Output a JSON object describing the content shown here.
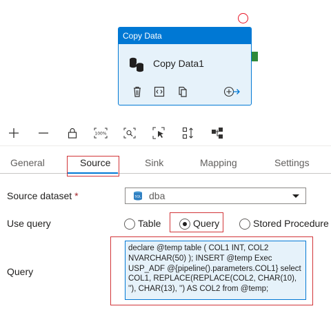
{
  "activity": {
    "type_title": "Copy Data",
    "name": "Copy Data1",
    "tools": [
      "delete-icon",
      "code-icon",
      "copy-icon",
      "add-output-icon"
    ]
  },
  "toolbar": {
    "items": [
      "zoom-in-icon",
      "zoom-out-icon",
      "lock-icon",
      "zoom-100-icon",
      "fit-to-window-icon",
      "select-icon",
      "auto-align-icon",
      "layout-icon"
    ],
    "zoom_100_label": "100%"
  },
  "tabs": [
    {
      "label": "General"
    },
    {
      "label": "Source"
    },
    {
      "label": "Sink"
    },
    {
      "label": "Mapping"
    },
    {
      "label": "Settings"
    }
  ],
  "active_tab": "Source",
  "form": {
    "source_dataset_label": "Source dataset",
    "required_mark": "*",
    "source_dataset_value": "dba",
    "use_query_label": "Use query",
    "use_query_options": [
      "Table",
      "Query",
      "Stored Procedure"
    ],
    "use_query_selected": "Query",
    "query_label": "Query",
    "query_text": "declare @temp table ( COL1 INT, COL2 NVARCHAR(50) ); INSERT @temp Exec USP_ADF @{pipeline().parameters.COL1} select COL1, REPLACE(REPLACE(COL2, CHAR(10), ''), CHAR(13), '') AS COL2 from @temp;"
  },
  "colors": {
    "accent": "#0078d4",
    "highlight_red": "#d13438",
    "activity_bg": "#e6f2fa",
    "port_green": "#2f8a3a"
  }
}
